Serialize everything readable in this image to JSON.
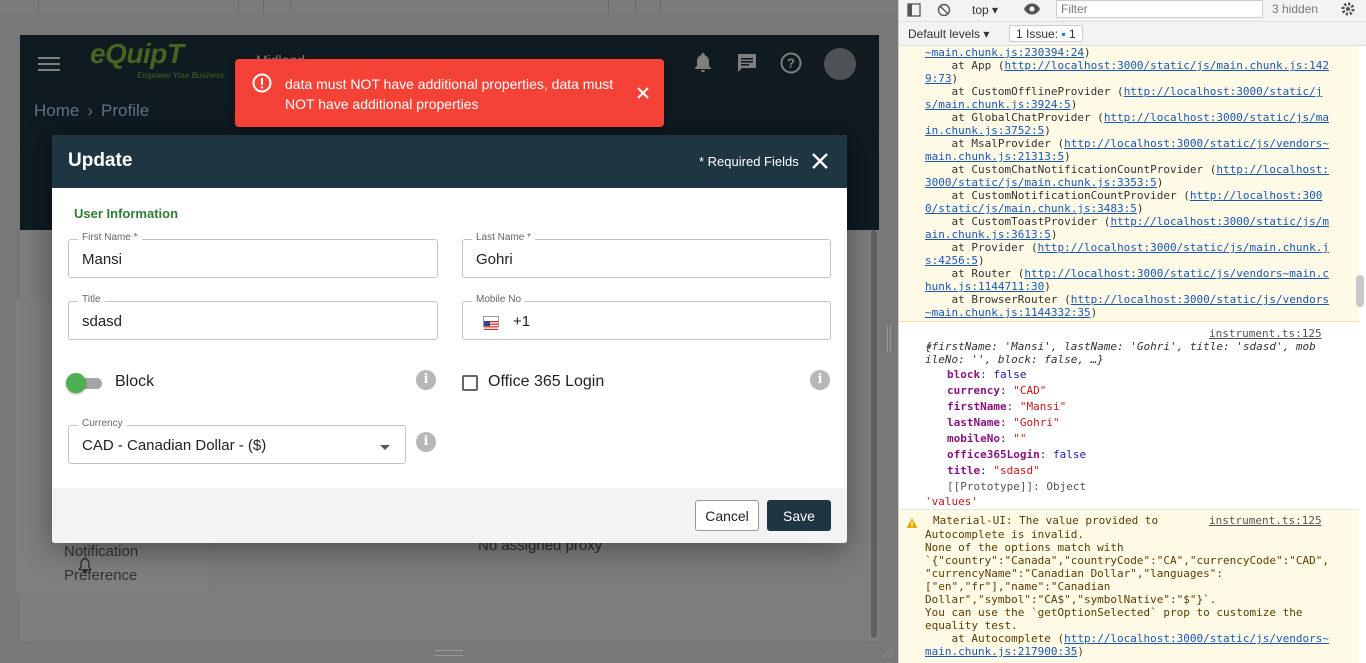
{
  "app": {
    "logo_text": "eQuipT",
    "logo_tagline": "Empower Your Business",
    "header_text": "Midland",
    "breadcrumb": [
      "Home",
      "Profile"
    ],
    "breadcrumb_sep": "›",
    "sidebar_item": "Notification Preference",
    "proxy_text": "No assigned proxy",
    "colors": {
      "header_bg": "#1e3542",
      "accent_green": "#8cc63f",
      "error": "#f44336"
    }
  },
  "toast": {
    "message": "data must NOT have additional properties, data must NOT have additional properties",
    "icon": "error-circle-icon"
  },
  "modal": {
    "title": "Update",
    "required_note": "* Required Fields",
    "section_title": "User Information",
    "fields": {
      "first_name": {
        "label": "First Name *",
        "value": "Mansi"
      },
      "last_name": {
        "label": "Last Name *",
        "value": "Gohri"
      },
      "title": {
        "label": "Title",
        "value": "sdasd"
      },
      "mobile": {
        "label": "Mobile No",
        "value": "+1"
      },
      "currency": {
        "label": "Currency",
        "value": "CAD - Canadian Dollar - ($)"
      }
    },
    "block": {
      "label": "Block",
      "checked": true
    },
    "office365": {
      "label": "Office 365 Login",
      "checked": false
    },
    "cancel_label": "Cancel",
    "save_label": "Save"
  },
  "devtools": {
    "context": "top",
    "filter_placeholder": "Filter",
    "hidden_count": "3 hidden",
    "levels": "Default levels",
    "issues": "1 Issue:",
    "issues_count": "1",
    "source": "instrument.ts:125",
    "source2": "instrument.ts:125",
    "stack_lines": [
      "~main.chunk.js:230394:24)",
      "    at App (http://localhost:3000/static/js/main.chunk.js:142",
      "9:73)",
      "    at CustomOfflineProvider (http://localhost:3000/static/j",
      "s/main.chunk.js:3924:5)",
      "    at GlobalChatProvider (http://localhost:3000/static/js/ma",
      "in.chunk.js:3752:5)",
      "    at MsalProvider (http://localhost:3000/static/js/vendors~",
      "main.chunk.js:21313:5)",
      "    at CustomChatNotificationCountProvider (http://localhost:",
      "3000/static/js/main.chunk.js:3353:5)",
      "    at CustomNotificationCountProvider (http://localhost:300",
      "0/static/js/main.chunk.js:3483:5)",
      "    at CustomToastProvider (http://localhost:3000/static/js/m",
      "ain.chunk.js:3613:5)",
      "    at Provider (http://localhost:3000/static/js/main.chunk.j",
      "s:4256:5)",
      "    at Router (http://localhost:3000/static/js/vendors~main.c",
      "hunk.js:1144711:30)",
      "    at BrowserRouter (http://localhost:3000/static/js/vendors",
      "~main.chunk.js:1144332:35)"
    ],
    "obj_summary_1": "{firstName: 'Mansi', lastName: 'Gohri', title: 'sdasd', mob",
    "obj_summary_2": "ileNo: '', block: false, …}",
    "obj_props": [
      [
        "block",
        "false"
      ],
      [
        "currency",
        "\"CAD\""
      ],
      [
        "firstName",
        "\"Mansi\""
      ],
      [
        "lastName",
        "\"Gohri\""
      ],
      [
        "mobileNo",
        "\"\""
      ],
      [
        "office365Login",
        "false"
      ],
      [
        "title",
        "\"sdasd\""
      ]
    ],
    "prototype": "[[Prototype]]: Object",
    "values_line": "'values'",
    "warn_lines": [
      "Material-UI: The value provided to",
      "Autocomplete is invalid.",
      "None of the options match with",
      "`{\"country\":\"Canada\",\"countryCode\":\"CA\",\"currencyCode\":\"CAD\",",
      "\"currencyName\":\"Canadian Dollar\",\"languages\":",
      "[\"en\",\"fr\"],\"name\":\"Canadian",
      "Dollar\",\"symbol\":\"CA$\",\"symbolNative\":\"$\"}`.",
      "You can use the `getOptionSelected` prop to customize the",
      "equality test.",
      "    at Autocomplete (http://localhost:3000/static/js/vendors~",
      "main.chunk.js:217900:35)"
    ]
  }
}
